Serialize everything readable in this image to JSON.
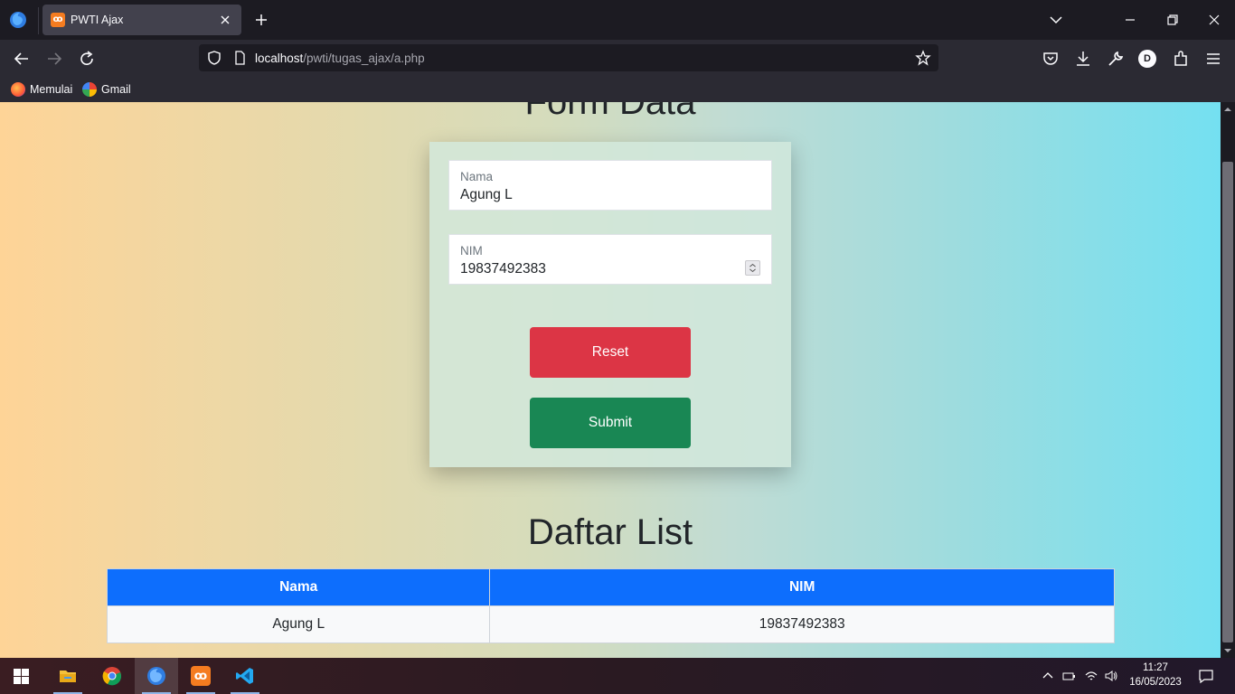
{
  "browser": {
    "tab_title": "PWTI Ajax",
    "url_host": "localhost",
    "url_path": "/pwti/tugas_ajax/a.php",
    "profile_initial": "D",
    "bookmarks": [
      {
        "label": "Memulai",
        "icon": "firefox-icon"
      },
      {
        "label": "Gmail",
        "icon": "google-icon"
      }
    ]
  },
  "page": {
    "form_title": "Form Data",
    "fields": {
      "nama": {
        "label": "Nama",
        "value": "Agung L"
      },
      "nim": {
        "label": "NIM",
        "value": "19837492383"
      }
    },
    "buttons": {
      "reset": "Reset",
      "submit": "Submit"
    },
    "list_title": "Daftar List",
    "table": {
      "headers": [
        "Nama",
        "NIM"
      ],
      "rows": [
        [
          "Agung L",
          "19837492383"
        ]
      ]
    }
  },
  "taskbar": {
    "apps": [
      "file-explorer-icon",
      "chrome-icon",
      "firefox-icon",
      "xampp-icon",
      "vscode-icon"
    ],
    "active_app": "firefox-icon",
    "time": "11:27",
    "date": "16/05/2023"
  },
  "colors": {
    "reset_button": "#dc3545",
    "submit_button": "#198754",
    "table_header": "#0d6efd",
    "gradient_left": "#fed497",
    "gradient_right": "#74e0f1"
  }
}
